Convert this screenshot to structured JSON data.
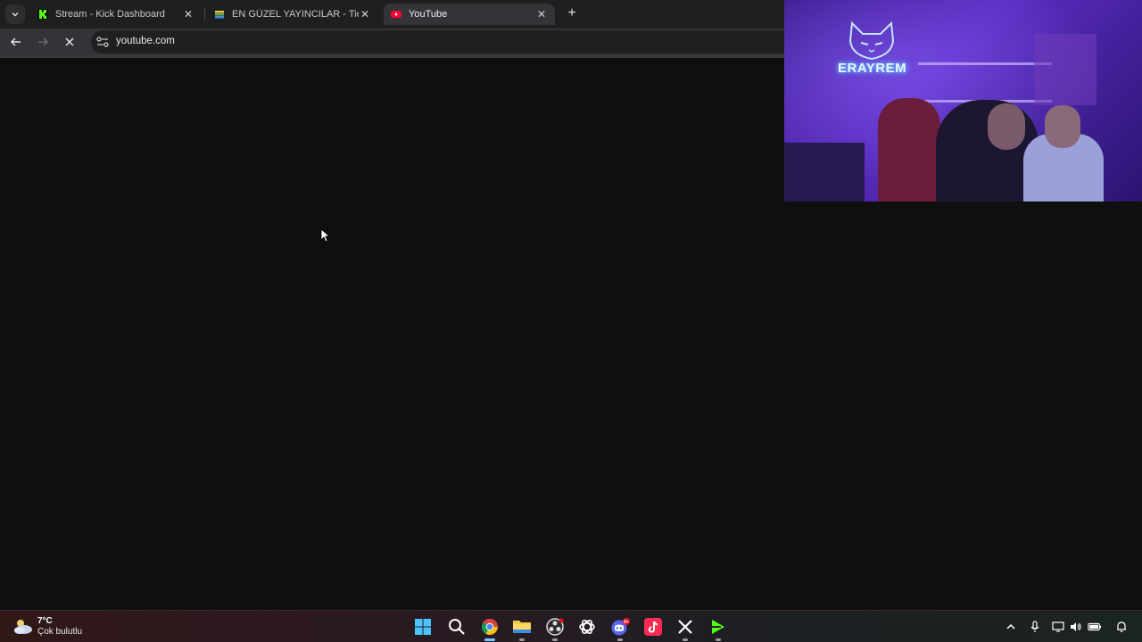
{
  "browser": {
    "tabs": [
      {
        "title": "Stream - Kick Dashboard",
        "favicon": "kick-icon",
        "active": false
      },
      {
        "title": "EN GÜZEL YAYINCILAR - Tier Lis",
        "favicon": "tierlist-icon",
        "active": false
      },
      {
        "title": "YouTube",
        "favicon": "youtube-icon",
        "active": true
      }
    ],
    "close_glyph": "✕",
    "new_tab_glyph": "+",
    "url": "youtube.com"
  },
  "webcam": {
    "overlay_text": "ERAYREM"
  },
  "taskbar": {
    "weather": {
      "temperature": "7°C",
      "condition": "Çok bulutlu",
      "icon": "cloudy-night-icon"
    },
    "apps": [
      "start-icon",
      "search-icon",
      "chrome-icon",
      "file-explorer-icon",
      "obs-icon",
      "chatgpt-icon",
      "discord-icon",
      "tiktok-icon",
      "x-icon",
      "kick-studio-icon"
    ],
    "discord_badge": "9+",
    "tray": [
      "chevron-up-icon",
      "microphone-icon",
      "display-icon",
      "volume-icon",
      "battery-icon",
      "notification-bell-icon"
    ]
  },
  "colors": {
    "page_bg": "#0f0f0f",
    "tab_strip": "#1f1f1f",
    "toolbar": "#333438",
    "kick_green": "#53fc18",
    "youtube_red": "#ff0033"
  }
}
